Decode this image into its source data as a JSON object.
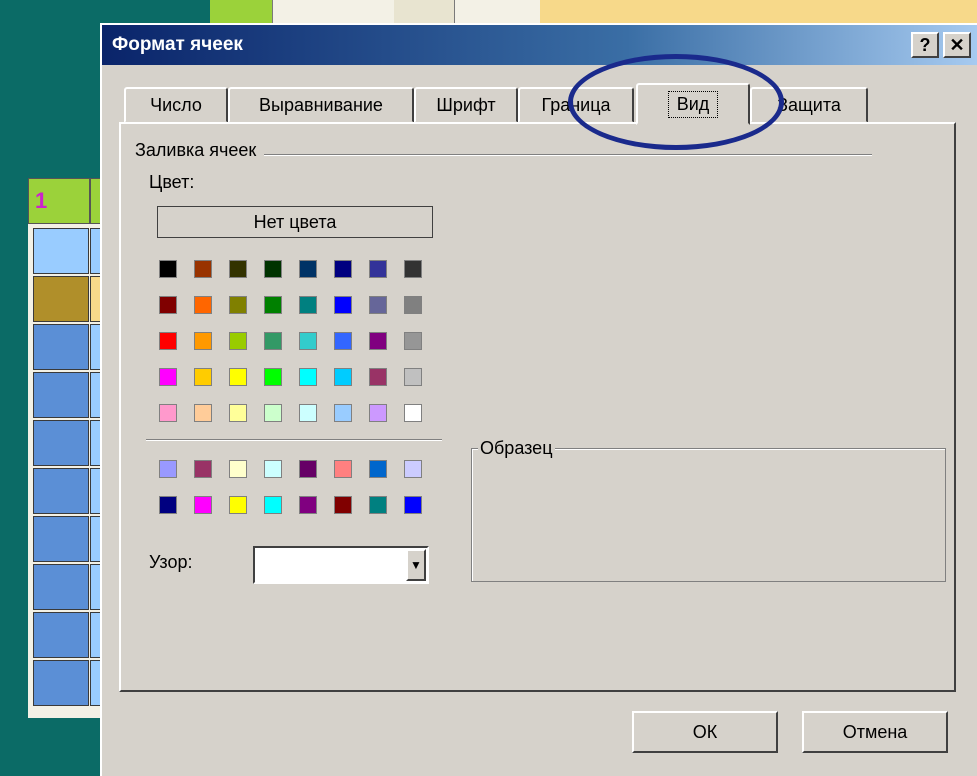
{
  "dialog": {
    "title": "Формат ячеек",
    "help_label": "?",
    "close_label": "✕"
  },
  "tabs": [
    {
      "label": "Число"
    },
    {
      "label": "Выравнивание"
    },
    {
      "label": "Шрифт"
    },
    {
      "label": "Граница"
    },
    {
      "label": "Вид",
      "active": true
    },
    {
      "label": "Защита"
    }
  ],
  "fill_group": {
    "title": "Заливка ячеек",
    "color_label": "Цвет:",
    "no_color_label": "Нет цвета"
  },
  "palette_main": [
    [
      "#000000",
      "#993300",
      "#333300",
      "#003300",
      "#003366",
      "#000080",
      "#333399",
      "#333333"
    ],
    [
      "#800000",
      "#ff6600",
      "#808000",
      "#008000",
      "#008080",
      "#0000ff",
      "#666699",
      "#808080"
    ],
    [
      "#ff0000",
      "#ff9900",
      "#99cc00",
      "#339966",
      "#33cccc",
      "#3366ff",
      "#800080",
      "#969696"
    ],
    [
      "#ff00ff",
      "#ffcc00",
      "#ffff00",
      "#00ff00",
      "#00ffff",
      "#00ccff",
      "#993366",
      "#c0c0c0"
    ],
    [
      "#ff99cc",
      "#ffcc99",
      "#ffff99",
      "#ccffcc",
      "#ccffff",
      "#99ccff",
      "#cc99ff",
      "#ffffff"
    ]
  ],
  "palette_chart": [
    [
      "#9999ff",
      "#993366",
      "#ffffcc",
      "#ccffff",
      "#660066",
      "#ff8080",
      "#0066cc",
      "#ccccff"
    ],
    [
      "#000080",
      "#ff00ff",
      "#ffff00",
      "#00ffff",
      "#800080",
      "#800000",
      "#008080",
      "#0000ff"
    ]
  ],
  "pattern": {
    "label": "Узор:",
    "value": ""
  },
  "sample": {
    "title": "Образец"
  },
  "buttons": {
    "ok_label": "ОК",
    "cancel_label": "Отмена"
  },
  "background_sheet": {
    "header_label": "1",
    "row_colors": [
      "#99ccff",
      "#b08f2a",
      "#5b8fd6",
      "#5b8fd6",
      "#5b8fd6",
      "#5b8fd6",
      "#5b8fd6",
      "#5b8fd6",
      "#5b8fd6",
      "#5b8fd6"
    ]
  },
  "colors": {
    "annotation_ring": "#1a2a8c",
    "desktop": "#0b6b66",
    "dialog_face": "#d6d2cb"
  }
}
